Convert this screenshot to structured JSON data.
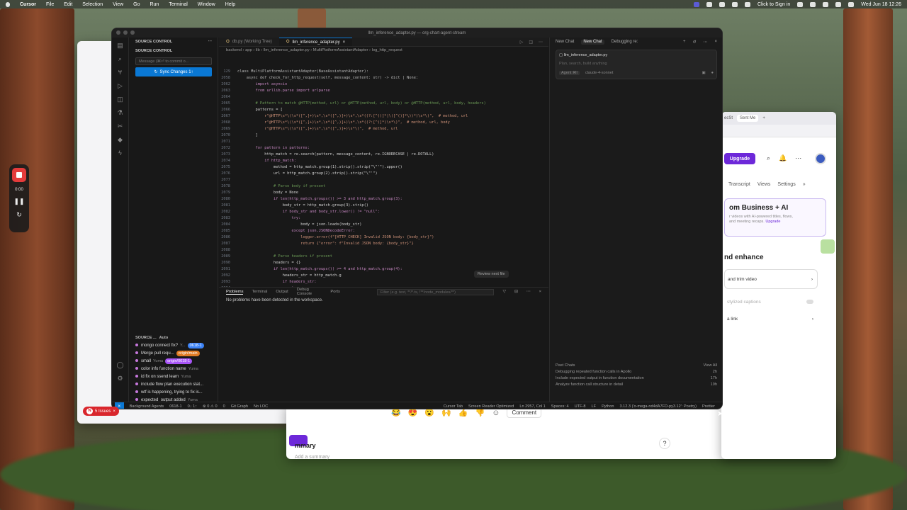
{
  "menubar": {
    "app": "Cursor",
    "items": [
      "File",
      "Edit",
      "Selection",
      "View",
      "Go",
      "Run",
      "Terminal",
      "Window",
      "Help"
    ],
    "status": "Click to Sign in",
    "clock": "Wed Jun 18  12:26"
  },
  "recorder": {
    "time": "0:00"
  },
  "editor": {
    "window_title": "llm_inference_adapter.py — org-chart-agent-stream",
    "sidebar": {
      "header": "SOURCE CONTROL",
      "section": "SOURCE CONTROL",
      "message_placeholder": "Message (⌘⏎ to commit o...",
      "sync_label": "Sync Changes 1↑",
      "graph_header": "SOURCE ...",
      "graph_mode": "Auto",
      "commits": [
        {
          "title": "mongo connect fix?",
          "author": "Y...",
          "chip": "0618-1",
          "chip_color": "#3b82f6"
        },
        {
          "title": "Merge pull requ...",
          "author": "",
          "chip": "origin/main",
          "chip_color": "#e07b24"
        },
        {
          "title": "small",
          "author": "Yuma",
          "chip": "origin/0618-1",
          "chip_color": "#a855f7"
        },
        {
          "title": "color info function name",
          "author": "Yuma",
          "chip": "",
          "chip_color": ""
        },
        {
          "title": "id fix on ssend learn",
          "author": "Yuma",
          "chip": "",
          "chip_color": ""
        },
        {
          "title": "include flow plan execution stat...",
          "author": "",
          "chip": "",
          "chip_color": ""
        },
        {
          "title": "wtf is happening, trying to fix is...",
          "author": "",
          "chip": "",
          "chip_color": ""
        },
        {
          "title": "expected_output added",
          "author": "Yuma",
          "chip": "",
          "chip_color": ""
        },
        {
          "title": "small",
          "author": "Yuma",
          "chip": "",
          "chip_color": ""
        }
      ]
    },
    "tabs": [
      {
        "label": "db.py (Working Tree)"
      },
      {
        "label": "llm_inference_adapter.py"
      }
    ],
    "breadcrumb": "backend › app › lib › llm_inference_adapter.py › MultiPlatformAssistantAdapter › log_http_request",
    "code_lines": [
      {
        "n": "129",
        "t": "class MultiPlatformAssistantAdapter(BaseAssistantAdapter):",
        "c": "ty"
      },
      {
        "n": "2058",
        "t": "    async def check_for_http_request(self, message_content: str) -> dict | None:",
        "c": ""
      },
      {
        "n": "2062",
        "t": "        import asyncio",
        "c": "kw"
      },
      {
        "n": "2063",
        "t": "        from urllib.parse import urlparse",
        "c": "kw"
      },
      {
        "n": "2064",
        "t": "",
        "c": ""
      },
      {
        "n": "2065",
        "t": "        # Pattern to match @HTTP(method, url) or @HTTP(method, url, body) or @HTTP(method, url, body, headers)",
        "c": "cm"
      },
      {
        "n": "2066",
        "t": "        patterns = [",
        "c": ""
      },
      {
        "n": "2067",
        "t": "            r\"@HTTP\\s*\\(\\s*([^,]+)\\s*,\\s*([^,)]+)\\s*,\\s*((?:[^()]*|\\([^()]*\\))*)\\s*\\)\",  # method, url",
        "c": "st"
      },
      {
        "n": "2068",
        "t": "            r\"@HTTP\\s*\\(\\s*([^,]+)\\s*,\\s*([^,)]+)\\s*,\\s*((?:[^)]*)\\s*\\)\",  # method, url, body",
        "c": "st"
      },
      {
        "n": "2069",
        "t": "            r\"@HTTP\\s*\\(\\s*([^,]+)\\s*,\\s*([^,)]+)\\s*\\)\",  # method, url",
        "c": "st"
      },
      {
        "n": "2070",
        "t": "        ]",
        "c": ""
      },
      {
        "n": "2071",
        "t": "",
        "c": ""
      },
      {
        "n": "2072",
        "t": "        for pattern in patterns:",
        "c": "kw"
      },
      {
        "n": "2073",
        "t": "            http_match = re.search(pattern, message_content, re.IGNORECASE | re.DOTALL)",
        "c": ""
      },
      {
        "n": "2074",
        "t": "            if http_match:",
        "c": "kw"
      },
      {
        "n": "2075",
        "t": "                method = http_match.group(1).strip().strip(\"\\\"'\").upper()",
        "c": ""
      },
      {
        "n": "2076",
        "t": "                url = http_match.group(2).strip().strip(\"\\\"'\")",
        "c": ""
      },
      {
        "n": "2077",
        "t": "",
        "c": ""
      },
      {
        "n": "2078",
        "t": "                # Parse body if present",
        "c": "cm"
      },
      {
        "n": "2079",
        "t": "                body = None",
        "c": ""
      },
      {
        "n": "2080",
        "t": "                if len(http_match.groups()) >= 3 and http_match.group(3):",
        "c": "kw"
      },
      {
        "n": "2081",
        "t": "                    body_str = http_match.group(3).strip()",
        "c": ""
      },
      {
        "n": "2082",
        "t": "                    if body_str and body_str.lower() != \"null\":",
        "c": "kw"
      },
      {
        "n": "2083",
        "t": "                        try:",
        "c": "kw"
      },
      {
        "n": "2084",
        "t": "                            body = json.loads(body_str)",
        "c": ""
      },
      {
        "n": "2085",
        "t": "                        except json.JSONDecodeError:",
        "c": "kw"
      },
      {
        "n": "2086",
        "t": "                            logger.error(f\"[HTTP_CHECK] Invalid JSON body: {body_str}\")",
        "c": "st"
      },
      {
        "n": "2087",
        "t": "                            return {\"error\": f\"Invalid JSON body: {body_str}\"}",
        "c": "st"
      },
      {
        "n": "2088",
        "t": "",
        "c": ""
      },
      {
        "n": "2089",
        "t": "                # Parse headers if present",
        "c": "cm"
      },
      {
        "n": "2090",
        "t": "                headers = {}",
        "c": ""
      },
      {
        "n": "2091",
        "t": "                if len(http_match.groups()) >= 4 and http_match.group(4):",
        "c": "kw"
      },
      {
        "n": "2092",
        "t": "                    headers_str = http_match.g",
        "c": ""
      },
      {
        "n": "2093",
        "t": "                    if headers_str:",
        "c": "kw"
      },
      {
        "n": "2094",
        "t": "                        try:",
        "c": "kw"
      }
    ],
    "review_pill": "Review next file",
    "panel": {
      "tabs": [
        "Problems",
        "Terminal",
        "Output",
        "Debug Console",
        "Ports"
      ],
      "filter_placeholder": "Filter (e.g. text, **/*.ts, !**/node_modules/**)",
      "message": "No problems have been detected in the workspace."
    },
    "chat": {
      "tabs": [
        "New Chat",
        "New Chat",
        "Debugging re:"
      ],
      "file": "llm_inference_adapter.py",
      "placeholder": "Plan, search, build anything",
      "mode": "Agent ⌘I",
      "model": "claude-4-sonnet",
      "past_title": "Past Chats",
      "view_all": "View All",
      "past": [
        {
          "title": "Debugging repeated function calls in Apollo",
          "age": "2h"
        },
        {
          "title": "Include expected output in function documentation",
          "age": "17h"
        },
        {
          "title": "Analyze function call structure in detail",
          "age": "19h"
        }
      ]
    },
    "status": {
      "remote": "✕",
      "agents": "Background Agents",
      "branch": "0618-1",
      "sync": "0↓ 1↑",
      "errors": "⊗ 0 ⚠ 0",
      "warnings": "0",
      "git_graph": "Git Graph",
      "loc": "No LOC",
      "right": [
        "Cursor Tab",
        "Screen Reader Optimized",
        "Ln 2957, Col 1",
        "Spaces: 4",
        "UTF-8",
        "LF",
        "Python",
        "3.12.3 ('o-mega-nd4dA7FD-py3.12': Poetry)",
        "Prettier"
      ]
    }
  },
  "issues": {
    "initial": "N",
    "label": "5 Issues"
  },
  "meet": {
    "comment": "Comment",
    "summary": "mmary",
    "add_summary": "Add a summary",
    "help": "?"
  },
  "right_window": {
    "tabs": [
      "ecSt",
      "Sent Me"
    ],
    "upgrade": "Upgrade",
    "nav": [
      "Transcript",
      "Views",
      "Settings"
    ],
    "card_title": "om Business + AI",
    "card_desc": "r videos with AI-powered titles, flows, and meeting recaps.",
    "card_link": "Upgrade",
    "section": "nd enhance",
    "items": [
      "and trim video",
      "stylized captions",
      "a link"
    ]
  }
}
